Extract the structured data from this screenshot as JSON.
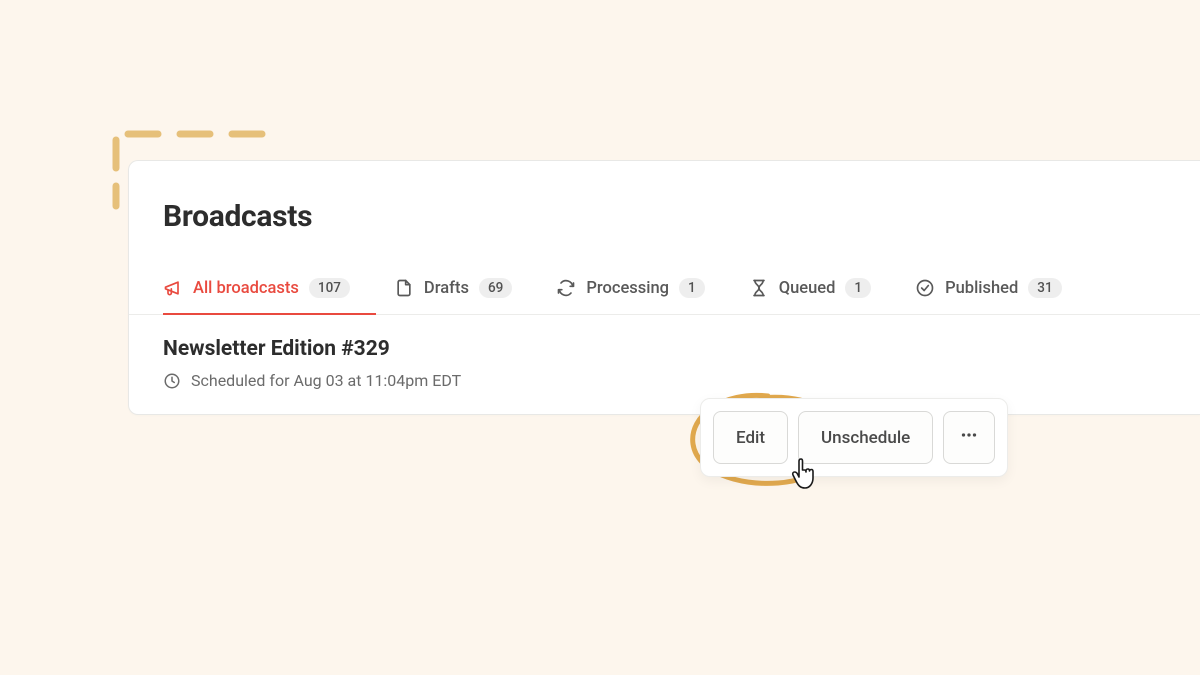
{
  "page": {
    "title": "Broadcasts"
  },
  "tabs": [
    {
      "label": "All broadcasts",
      "count": "107",
      "icon": "megaphone-icon",
      "active": true
    },
    {
      "label": "Drafts",
      "count": "69",
      "icon": "file-icon",
      "active": false
    },
    {
      "label": "Processing",
      "count": "1",
      "icon": "refresh-icon",
      "active": false
    },
    {
      "label": "Queued",
      "count": "1",
      "icon": "hourglass-icon",
      "active": false
    },
    {
      "label": "Published",
      "count": "31",
      "icon": "check-circle-icon",
      "active": false
    }
  ],
  "row": {
    "title": "Newsletter Edition #329",
    "schedule": "Scheduled for Aug 03 at 11:04pm EDT"
  },
  "actions": {
    "edit": "Edit",
    "unschedule": "Unschedule"
  }
}
